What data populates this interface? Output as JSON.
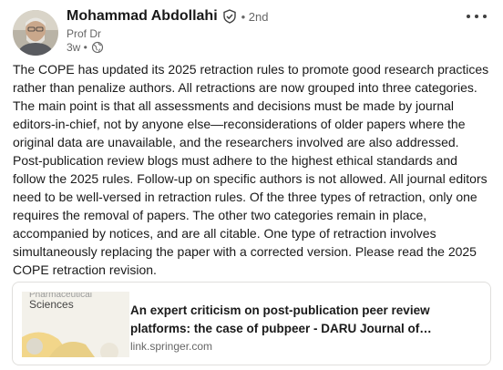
{
  "author": {
    "name": "Mohammad Abdollahi",
    "degree": "• 2nd",
    "headline": "Prof Dr",
    "time": "3w •"
  },
  "post": {
    "text": "The COPE has updated its 2025 retraction rules to promote good research practices rather than penalize authors. All retractions are now grouped into three categories. The main point is that all assessments and decisions must be made by journal editors-in-chief, not by anyone else—reconsiderations of older papers where the original data are unavailable, and the researchers involved are also addressed. Post-publication review blogs must adhere to the highest ethical standards and follow the 2025 rules. Follow-up on specific authors is not allowed. All journal editors need to be well-versed in retraction rules. Of the three types of retraction, only one requires the removal of papers. The other two categories remain in place, accompanied by notices, and are all citable. One type of retraction involves simultaneously replacing the paper with a corrected version. Please read the 2025 COPE retraction revision."
  },
  "link_card": {
    "thumbnail_text": "Sciences",
    "title": "An expert criticism on post-publication peer review platforms: the case of pubpeer - DARU Journal of…",
    "domain": "link.springer.com"
  },
  "icons": {
    "verified": "verified-shield-icon",
    "visibility": "globe-icon",
    "menu": "more-options-icon"
  },
  "colors": {
    "text": "#191919",
    "muted": "#666666",
    "border": "#e0dfdc",
    "thumb_bg": "#f3f1ea",
    "thumb_accent": "#f2d68a"
  }
}
